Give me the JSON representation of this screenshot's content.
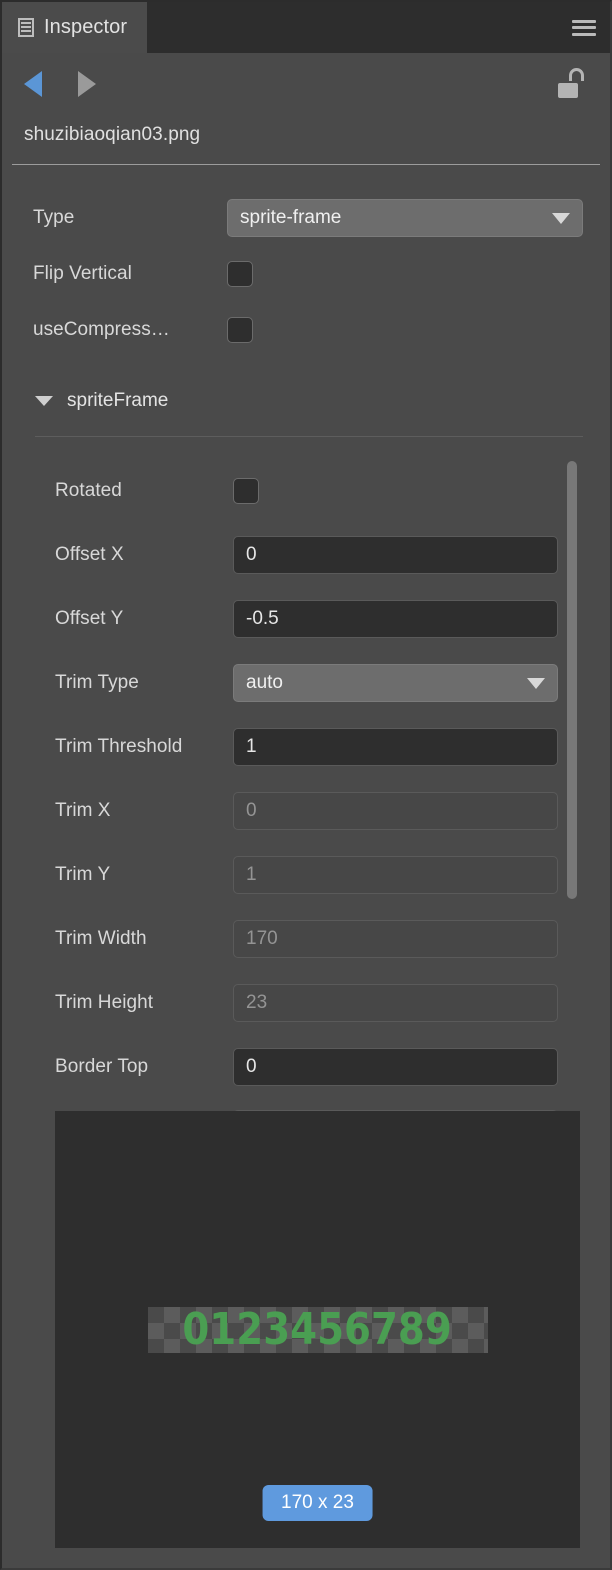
{
  "window": {
    "background_color": "#4a4a4a"
  },
  "tabbar": {
    "tab_label": "Inspector",
    "tab_icon": "inspector-icon",
    "menu_icon": "hamburger-menu-icon"
  },
  "navrow": {
    "prev_icon": "triangle-left-icon",
    "next_icon": "triangle-right-icon",
    "lock_icon": "unlocked-padlock-icon",
    "prev_color": "#5b96d6",
    "next_color": "#9a9a9a"
  },
  "asset": {
    "filename": "shuzibiaoqian03.png"
  },
  "properties": [
    {
      "label": "Type",
      "control": "select",
      "value": "sprite-frame"
    },
    {
      "label": "Flip Vertical",
      "control": "checkbox",
      "value": ""
    },
    {
      "label": "useCompress…",
      "control": "checkbox",
      "value": ""
    }
  ],
  "section": {
    "title": "spriteFrame",
    "expanded_icon": "chevron-down-icon"
  },
  "sprite_frame_fields": [
    {
      "label": "Rotated",
      "control": "checkbox",
      "value": "",
      "disabled": false
    },
    {
      "label": "Offset X",
      "control": "input",
      "value": "0",
      "disabled": false
    },
    {
      "label": "Offset Y",
      "control": "input",
      "value": "-0.5",
      "disabled": false
    },
    {
      "label": "Trim Type",
      "control": "select",
      "value": "auto",
      "disabled": false
    },
    {
      "label": "Trim Threshold",
      "control": "input",
      "value": "1",
      "disabled": false
    },
    {
      "label": "Trim X",
      "control": "input",
      "value": "0",
      "disabled": true
    },
    {
      "label": "Trim Y",
      "control": "input",
      "value": "1",
      "disabled": true
    },
    {
      "label": "Trim Width",
      "control": "input",
      "value": "170",
      "disabled": true
    },
    {
      "label": "Trim Height",
      "control": "input",
      "value": "23",
      "disabled": true
    },
    {
      "label": "Border Top",
      "control": "input",
      "value": "0",
      "disabled": false
    }
  ],
  "preview": {
    "sprite_text": "0123456789",
    "sprite_color": "#4a9e52",
    "size_badge": "170 x 23",
    "badge_color": "#5f9ade",
    "background_color": "#2e2e2e"
  },
  "scrollbar": {
    "thumb_color": "#787878"
  }
}
